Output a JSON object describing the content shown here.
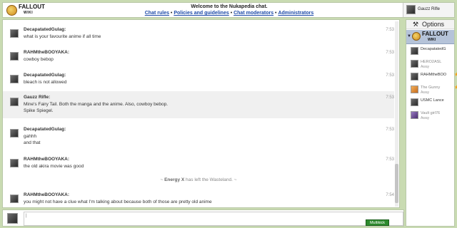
{
  "header": {
    "logo_title": "FALLOUT",
    "logo_sub": "WIKI",
    "welcome": "Welcome to the Nukapedia chat.",
    "links": [
      "Chat rules",
      "Policies and guidelines",
      "Chat moderators",
      "Administrators"
    ],
    "separator": " • ",
    "current_user": "Gauzz Rifle"
  },
  "messages": [
    {
      "user": "DecapatatedGulag:",
      "lines": [
        "what is your favourite anime if all time"
      ],
      "time": "7:53",
      "highlight": false
    },
    {
      "user": "RAHMtheBOOYAKA:",
      "lines": [
        "cowboy bebop"
      ],
      "time": "7:53",
      "highlight": false
    },
    {
      "user": "DecapatatedGulag:",
      "lines": [
        "bleach is not allowed"
      ],
      "time": "7:53",
      "highlight": false
    },
    {
      "user": "Gauzz Rifle:",
      "lines": [
        "Mine's Fairy Tail. Both the manga and the anime. Also, cowboy bebop.",
        "Spike Spiegel."
      ],
      "time": "7:53",
      "highlight": true
    },
    {
      "user": "DecapatatedGulag:",
      "lines": [
        "gahhh",
        "and that"
      ],
      "time": "7:53",
      "highlight": false
    },
    {
      "user": "RAHMtheBOOYAKA:",
      "lines": [
        "the old akira movie was good"
      ],
      "time": "7:53",
      "highlight": false
    },
    {
      "user": "RAHMtheBOOYAKA:",
      "lines": [
        "you might not have a clue what I'm talking about because both of those are pretty old anime"
      ],
      "time": "7:54",
      "highlight": false
    }
  ],
  "part_note": {
    "prefix": "~ ",
    "user": "Energy X",
    "text": " has left the Wasteland. ~"
  },
  "input": {
    "value": "|",
    "multikick": "Multikick"
  },
  "sidebar": {
    "options_icon": "tools-icon",
    "options_label": "Options",
    "wiki_title": "FALLOUT",
    "wiki_sub": "WIKI",
    "users": [
      {
        "name": "DecapatatedG...",
        "status": "",
        "star": false,
        "away": false
      },
      {
        "name": "HERO2ASL",
        "status": "Away",
        "star": false,
        "away": true
      },
      {
        "name": "RAHMtheBOO...",
        "status": "",
        "star": true,
        "away": false
      },
      {
        "name": "The Gunny",
        "status": "Away",
        "star": true,
        "away": true
      },
      {
        "name": "USMC Lance",
        "status": "",
        "star": false,
        "away": false
      },
      {
        "name": "Vault girl76",
        "status": "Away",
        "star": false,
        "away": true
      }
    ],
    "star_char": "★"
  },
  "colors": {
    "accent_link": "#1d4aa8",
    "button_green": "#2e8b2e",
    "wiki_row": "#b5c3d9"
  }
}
